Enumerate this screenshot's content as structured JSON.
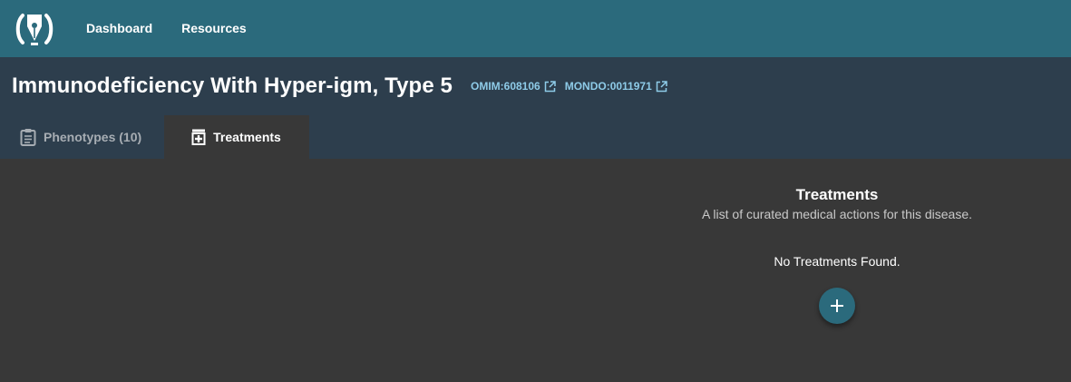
{
  "nav": {
    "items": [
      {
        "label": "Dashboard"
      },
      {
        "label": "Resources"
      }
    ]
  },
  "disease": {
    "title": "Immunodeficiency With Hyper-igm, Type 5",
    "links": [
      {
        "label": "OMIM:608106"
      },
      {
        "label": "MONDO:0011971"
      }
    ]
  },
  "tabs": [
    {
      "label": "Phenotypes (10)",
      "icon": "clipboard-icon",
      "active": false
    },
    {
      "label": "Treatments",
      "icon": "medical-kit-icon",
      "active": true
    }
  ],
  "treatments": {
    "title": "Treatments",
    "subtitle": "A list of curated medical actions for this disease.",
    "empty_message": "No Treatments Found.",
    "add_icon": "plus-icon"
  },
  "colors": {
    "topbar": "#2b6a7c",
    "header": "#2d3e4d",
    "body": "#383838",
    "link": "#8ecbe8"
  }
}
